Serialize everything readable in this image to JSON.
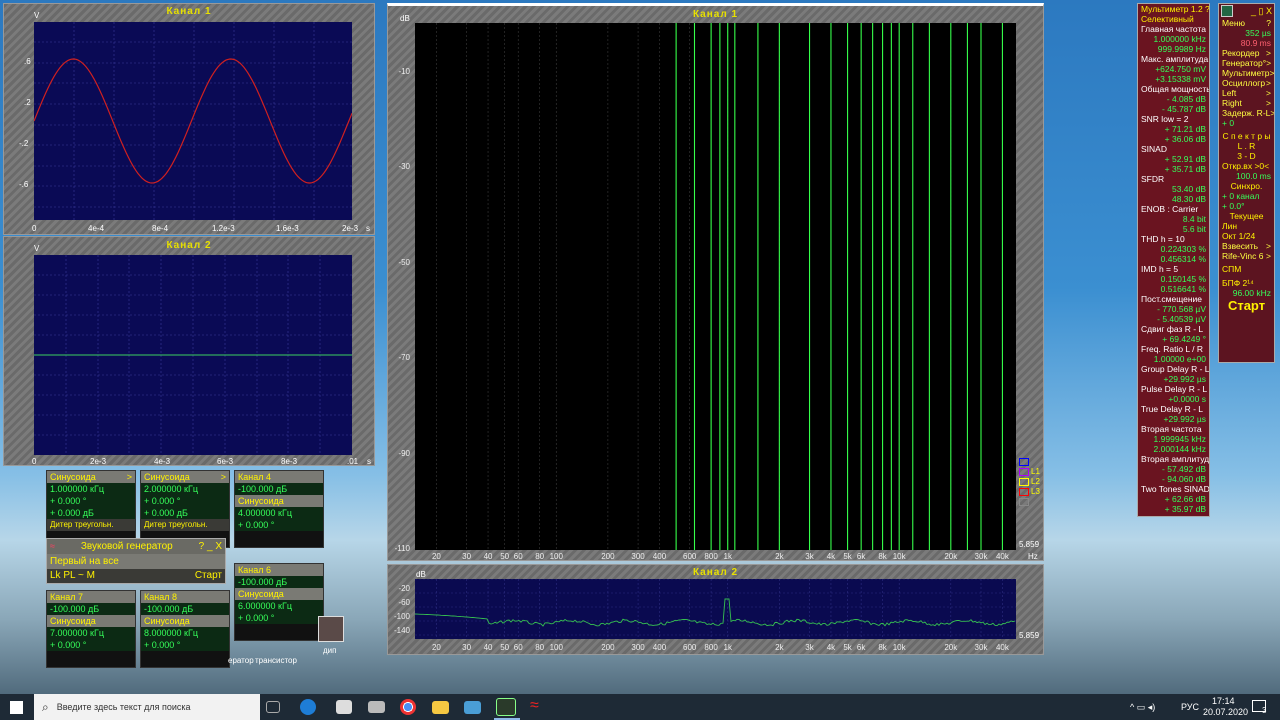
{
  "ch1_scope": {
    "title": "Канал 1",
    "unit": "V",
    "y_ticks": [
      ".6",
      ".2",
      "-.2",
      "-.6"
    ],
    "x_ticks": [
      "0",
      "4e-4",
      "8e-4",
      "1.2e-3",
      "1.6e-3",
      "2e-3",
      "s"
    ]
  },
  "ch2_scope": {
    "title": "Канал 2",
    "unit": "V",
    "x_ticks": [
      "0",
      "2e-3",
      "4e-3",
      "6e-3",
      "8e-3",
      ".01",
      "s"
    ]
  },
  "fft1": {
    "title": "Канал 1",
    "unit": "dB",
    "y_ticks": [
      "-10",
      "-30",
      "-50",
      "-70",
      "-90",
      "-110"
    ],
    "x_ticks": [
      "20",
      "30",
      "40",
      "50",
      "60",
      "80",
      "100",
      "200",
      "300",
      "400",
      "600",
      "800",
      "1k",
      "2k",
      "3k",
      "4k",
      "5k",
      "6k",
      "8k",
      "10k",
      "20k",
      "30k",
      "40k"
    ],
    "hz": "Hz",
    "level": "5.859",
    "legend": [
      "L1",
      "L2",
      "L3"
    ]
  },
  "fft2": {
    "title": "Канал 2",
    "unit": "dB",
    "y_ticks": [
      "-20",
      "-60",
      "-100",
      "-140"
    ],
    "level": "5.859"
  },
  "multimeter": {
    "title": "Мультиметр 1.2 ?",
    "mode": "Селективный",
    "rows": [
      {
        "h": "Главная частота",
        "v": [
          "1.000000 kHz",
          "999.9989 Hz"
        ]
      },
      {
        "h": "Макс. амплитуда",
        "v": [
          "+624.750 mV",
          "+3.15338 mV"
        ]
      },
      {
        "h": "Общая мощность",
        "v": [
          "- 4.085 dB",
          "- 45.787 dB"
        ]
      },
      {
        "h": "SNR      low = 2",
        "v": [
          "+ 71.21 dB",
          "+ 36.06 dB"
        ]
      },
      {
        "h": "SINAD",
        "v": [
          "+ 52.91 dB",
          "+ 35.71 dB"
        ]
      },
      {
        "h": "SFDR",
        "v": [
          "53.40 dB",
          "48.30 dB"
        ]
      },
      {
        "h": "ENOB : Carrier",
        "v": [
          "8.4 bit",
          "5.6 bit"
        ]
      },
      {
        "h": "THD      h = 10",
        "v": [
          "0.224303 %",
          "0.456314 %"
        ]
      },
      {
        "h": "IMD      h = 5",
        "v": [
          "0.150145 %",
          "0.516641 %"
        ]
      },
      {
        "h": "Пост.смещение",
        "v": [
          "- 770.568 µV",
          "- 5.40539 µV"
        ]
      },
      {
        "h": "Сдвиг фаз R - L",
        "v": [
          "+ 69.4249 °"
        ]
      },
      {
        "h": "Freq. Ratio  L / R",
        "v": [
          "1.00000 e+00"
        ]
      },
      {
        "h": "Group Delay R - L",
        "v": [
          "+29.992 µs"
        ]
      },
      {
        "h": "Pulse Delay R - L",
        "v": [
          "+0.0000 s"
        ]
      },
      {
        "h": "True  Delay R - L",
        "v": [
          "+29.992 µs"
        ]
      },
      {
        "h": "Вторая частота",
        "v": [
          "1.999945 kHz",
          "2.000144 kHz"
        ]
      },
      {
        "h": "Вторая амплитуда",
        "v": [
          "- 57.492 dB",
          "- 94.060 dB"
        ]
      },
      {
        "h": "Two Tones SINAD",
        "v": [
          "+ 62.66 dB",
          "+ 35.97 dB"
        ]
      }
    ]
  },
  "menu": {
    "title": "Меню",
    "q": "?",
    "time_us": "352 µs",
    "pct": "80.9 ms",
    "items": [
      "Рекордер",
      "Генератор°",
      "Мультиметр",
      "Осциллогр",
      "Left",
      "Right",
      "Задерж. R-L"
    ],
    "zero": "+ 0",
    "spectra": "С п е к т р ы",
    "lr": "L . R",
    "threed": "3 - D",
    "open_in": "Откр.вх >0<",
    "open_ms": "100.0 ms",
    "sync": "Синхро.",
    "sync1": "+ 0 канал",
    "sync2": "+ 0.0°",
    "current": "Текущее",
    "lin": "Лин",
    "okt": "Окт 1/24",
    "weigh": "Взвесить",
    "rife": "Rife-Vinc 6",
    "spm": "СПМ",
    "bpf": "БПФ 2¹⁴",
    "freq": "96.00 kHz",
    "start": "Старт"
  },
  "gens": [
    {
      "title": "Синусоида",
      "f": "1.000000 кГц",
      "p": "+   0.000 °",
      "a": "+   0.000 дБ",
      "d": "Дитер треугольн."
    },
    {
      "title": "Синусоида",
      "f": "2.000000 кГц",
      "p": "+   0.000 °",
      "a": "+   0.000 дБ",
      "d": "Дитер треугольн."
    },
    {
      "title": "Канал 4",
      "f": "-100.000 дБ",
      "p": "Синусоида",
      "a": "4.000000 кГц",
      "d": "+   0.000 °"
    },
    {
      "title": "Канал 7",
      "f": "-100.000 дБ",
      "p": "Синусоида",
      "a": "7.000000 кГц",
      "d": "+   0.000 °"
    },
    {
      "title": "Канал 8",
      "f": "-100.000 дБ",
      "p": "Синусоида",
      "a": "8.000000 кГц",
      "d": "+   0.000 °"
    },
    {
      "title": "Канал 6",
      "f": "-100.000 дБ",
      "p": "Синусоида",
      "a": "6.000000 кГц",
      "d": "+   0.000 °"
    }
  ],
  "generator": {
    "title": "Звуковой генератор",
    "ctrl": "?  _  X",
    "first": "Первый на все",
    "mode": "Lk PL  ~  M",
    "start": "Старт"
  },
  "desktop": {
    "icon1": "трансистор",
    "icon2": "дип",
    "icon3": "ератор"
  },
  "taskbar": {
    "search": "Введите здесь текст для поиска",
    "lang": "РУС",
    "time": "17:14",
    "date": "20.07.2020",
    "badge": "3"
  }
}
